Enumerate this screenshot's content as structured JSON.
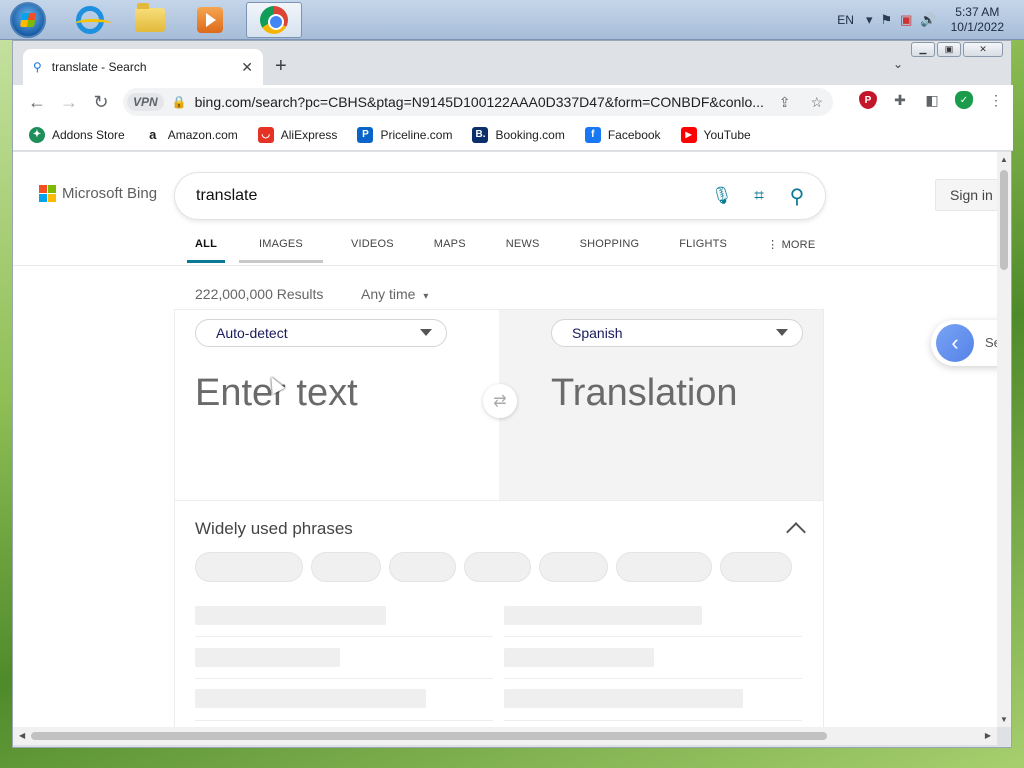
{
  "taskbar": {
    "tray": {
      "language": "EN",
      "time": "5:37 AM",
      "date": "10/1/2022"
    }
  },
  "browser": {
    "tab_title": "translate - Search",
    "url": "bing.com/search?pc=CBHS&ptag=N9145D100122AAA0D337D47&form=CONBDF&conlo...",
    "vpn_label": "VPN",
    "bookmarks": [
      {
        "label": "Addons Store",
        "icon": "addons-store-icon",
        "color": "#1e8e5a"
      },
      {
        "label": "Amazon.com",
        "icon": "amazon-icon",
        "color": "#222222"
      },
      {
        "label": "AliExpress",
        "icon": "aliexpress-icon",
        "color": "#e43225"
      },
      {
        "label": "Priceline.com",
        "icon": "priceline-icon",
        "color": "#0a63c9"
      },
      {
        "label": "Booking.com",
        "icon": "booking-icon",
        "color": "#0b2f6b"
      },
      {
        "label": "Facebook",
        "icon": "facebook-icon",
        "color": "#1877f2"
      },
      {
        "label": "YouTube",
        "icon": "youtube-icon",
        "color": "#ff0000"
      }
    ]
  },
  "bing": {
    "brand": "Microsoft Bing",
    "query": "translate",
    "sign_in": "Sign in",
    "scopes": [
      "ALL",
      "IMAGES",
      "VIDEOS",
      "MAPS",
      "NEWS",
      "SHOPPING",
      "FLIGHTS",
      "MORE"
    ],
    "result_count": "222,000,000 Results",
    "time_filter": "Any time",
    "accent": "#0c7a96",
    "translator": {
      "source_language": "Auto-detect",
      "target_language": "Spanish",
      "input_placeholder": "Enter text",
      "output_placeholder": "Translation",
      "phrases_title": "Widely used phrases"
    },
    "side_panel_text": "Se"
  }
}
